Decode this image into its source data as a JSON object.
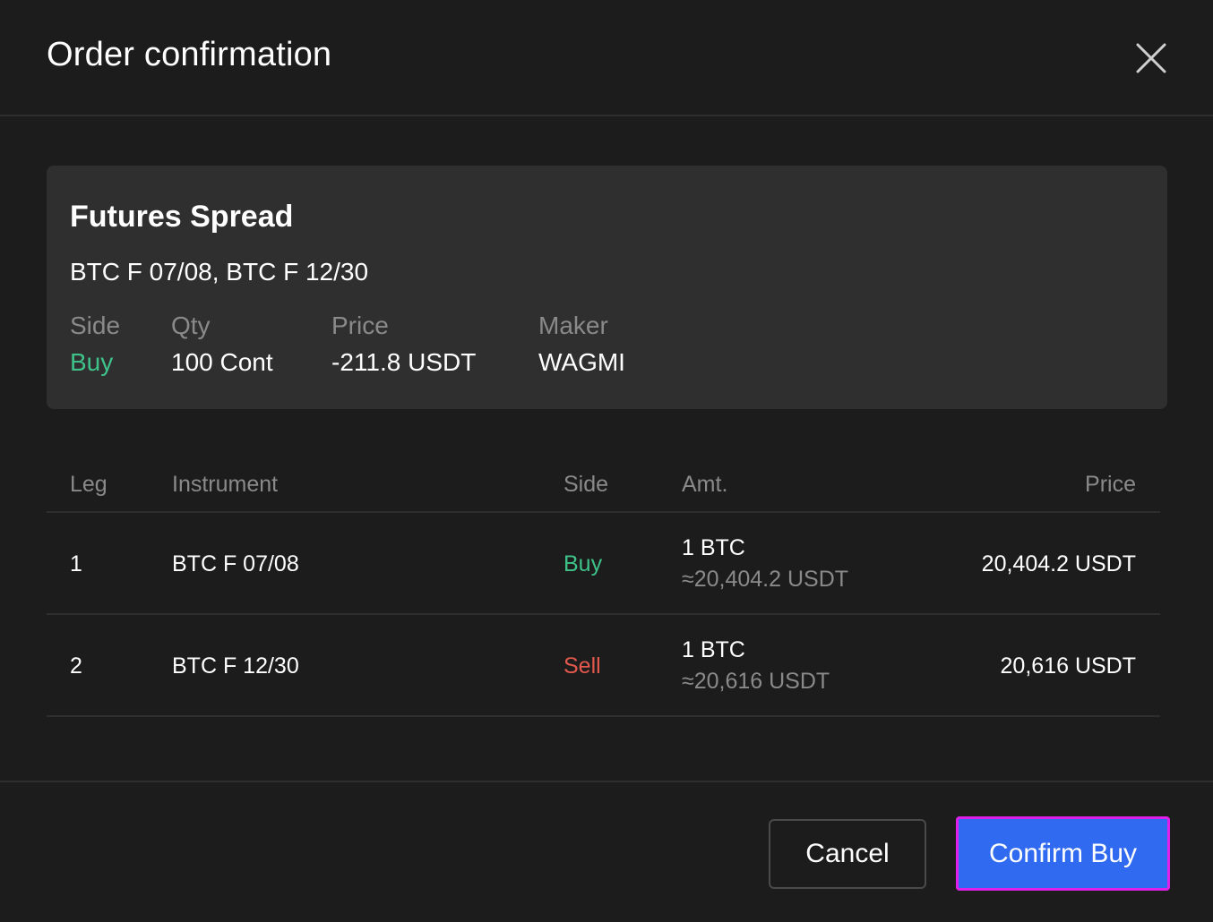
{
  "dialog": {
    "title": "Order confirmation",
    "close_icon": "close-icon"
  },
  "summary": {
    "title": "Futures Spread",
    "instruments": "BTC F 07/08, BTC F 12/30",
    "side_label": "Side",
    "side_value": "Buy",
    "qty_label": "Qty",
    "qty_value": "100 Cont",
    "price_label": "Price",
    "price_value": "-211.8 USDT",
    "maker_label": "Maker",
    "maker_value": "WAGMI"
  },
  "table": {
    "headers": {
      "leg": "Leg",
      "instrument": "Instrument",
      "side": "Side",
      "amt": "Amt.",
      "price": "Price"
    },
    "rows": [
      {
        "leg": "1",
        "instrument": "BTC F 07/08",
        "side": "Buy",
        "amt": "1 BTC",
        "amt_approx": "≈20,404.2 USDT",
        "price": "20,404.2 USDT"
      },
      {
        "leg": "2",
        "instrument": "BTC F 12/30",
        "side": "Sell",
        "amt": "1 BTC",
        "amt_approx": "≈20,616 USDT",
        "price": "20,616 USDT"
      }
    ]
  },
  "footer": {
    "cancel_label": "Cancel",
    "confirm_label": "Confirm Buy"
  },
  "colors": {
    "background": "#1c1c1c",
    "card": "#2f2f2f",
    "buy": "#3ec28a",
    "sell": "#e2584d",
    "primary": "#2f6af0",
    "highlight": "#e020e8"
  }
}
